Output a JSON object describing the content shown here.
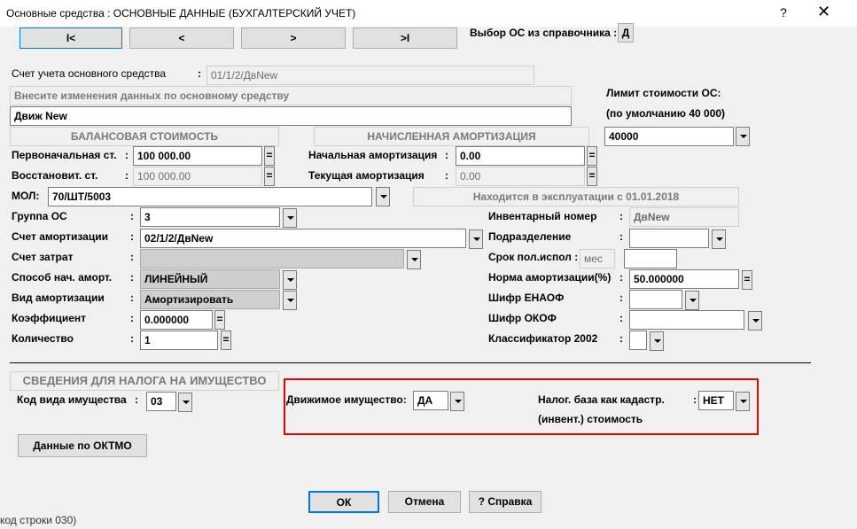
{
  "window": {
    "title": "Основные средства : ОСНОВНЫЕ ДАННЫЕ (БУХГАЛТЕРСКИЙ УЧЕТ)",
    "help": "?",
    "close": "✕"
  },
  "nav": {
    "first": "I<",
    "prev": "<",
    "next": ">",
    "last": ">I"
  },
  "selection": {
    "label": "Выбор ОС из справочника :",
    "button": "Д"
  },
  "account": {
    "label": "Счет учета основного средства",
    "colon": ":",
    "value": "01/1/2/ДвNew"
  },
  "changes": {
    "hint": "Внесите изменения данных по основному средству",
    "value": "Движ New"
  },
  "limit": {
    "label1": "Лимит стоимости ОС:",
    "label2": "(по умолчанию 40 000)",
    "value": "40000"
  },
  "balance": {
    "header": "БАЛАНСОВАЯ СТОИМОСТЬ",
    "initial_label": "Первоначальная ст.",
    "initial_value": "100 000.00",
    "restored_label": "Восстановит.  ст.",
    "restored_value": "100 000.00"
  },
  "amortization": {
    "header": "НАЧИСЛЕННАЯ АМОРТИЗАЦИЯ",
    "initial_label": "Начальная амортизация",
    "initial_value": "0.00",
    "current_label": "Текущая   амортизация",
    "current_value": "0.00"
  },
  "eq": "=",
  "colon": ":",
  "mol": {
    "label": "МОЛ:",
    "value": "70/ШТ/5003"
  },
  "exploitation": "Находится в эксплуатации с 01.01.2018",
  "left_fields": [
    {
      "label": "Группа ОС",
      "value": "3"
    },
    {
      "label": "Счет амортизации",
      "value": "02/1/2/ДвNew"
    },
    {
      "label": "Счет затрат",
      "value": ""
    },
    {
      "label": "Способ нач. аморт.",
      "value": "ЛИНЕЙНЫЙ"
    },
    {
      "label": "Вид амортизации",
      "value": "Амортизировать"
    },
    {
      "label": "Коэффициент",
      "value": "0.000000"
    },
    {
      "label": "Количество",
      "value": "1"
    }
  ],
  "right_fields": {
    "inventory_label": "Инвентарный номер",
    "inventory_value": "ДвNew",
    "division_label": "Подразделение",
    "division_value": "",
    "term_label": "Срок пол.испол :",
    "term_unit": "мес",
    "term_value": "",
    "norm_label": "Норма амортизации(%)",
    "norm_value": "50.000000",
    "enaof_label": "Шифр ЕНАОФ",
    "enaof_value": "",
    "okof_label": "Шифр ОКОФ",
    "okof_value": "",
    "classifier_label": "Классификатор 2002",
    "classifier_value": ""
  },
  "tax": {
    "header": "СВЕДЕНИЯ ДЛЯ НАЛОГА НА ИМУЩЕСТВО",
    "kind_label": "Код вида имущества",
    "kind_value": "03",
    "movable_label": "Движимое имущество:",
    "movable_value": "ДА",
    "cadastral_label1": "Налог. база как кадастр.",
    "cadastral_label2": "(инвент.) стоимость",
    "cadastral_value": "НЕТ",
    "oktmo_button": "Данные по ОКТМО"
  },
  "buttons": {
    "ok": "ОК",
    "cancel": "Отмена",
    "help": "? Справка"
  },
  "background_text": "код строки 030)",
  "colors": {
    "highlight": "#e00000",
    "focus": "#0078d7"
  }
}
